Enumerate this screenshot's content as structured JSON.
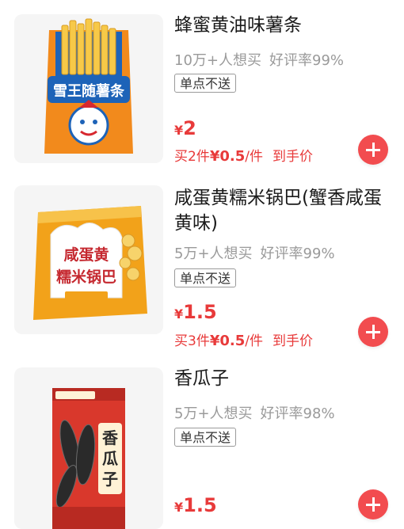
{
  "products": [
    {
      "title": "蜂蜜黄油味薯条",
      "want": "10万+人想买",
      "rating": "好评率99%",
      "tag": "单点不送",
      "currency": "¥",
      "price": "2",
      "promo": {
        "qty": "买2件",
        "amount": "¥0.5",
        "unit": "/件",
        "suffix": "到手价"
      },
      "package": {
        "icon": "fries-bag-icon",
        "brand_text": "雪王随薯条",
        "colors": {
          "bag": "#f28a1c",
          "fries": "#f7c948",
          "label": "#1d63b8"
        }
      }
    },
    {
      "title": "咸蛋黄糯米锅巴(蟹香咸蛋黄味)",
      "want": "5万+人想买",
      "rating": "好评率99%",
      "tag": "单点不送",
      "currency": "¥",
      "price": "1.5",
      "promo": {
        "qty": "买3件",
        "amount": "¥0.5",
        "unit": "/件",
        "suffix": "到手价"
      },
      "package": {
        "icon": "rice-crisp-bag-icon",
        "brand_text": "咸蛋黄糯米锅巴",
        "colors": {
          "bag": "#f2a21a",
          "label": "#ffffff",
          "text": "#c5282f"
        }
      }
    },
    {
      "title": "香瓜子",
      "want": "5万+人想买",
      "rating": "好评率98%",
      "tag": "单点不送",
      "currency": "¥",
      "price": "1.5",
      "package": {
        "icon": "sunflower-seed-bag-icon",
        "brand_text": "香瓜子",
        "colors": {
          "bag": "#d9382c",
          "seeds": "#2a2a2a",
          "label": "#fff2d6"
        }
      }
    }
  ],
  "colors": {
    "accent": "#e83a3a",
    "add_button": "#f24c4f",
    "muted_text": "#9a9a9a",
    "title_text": "#1a1a1a"
  }
}
